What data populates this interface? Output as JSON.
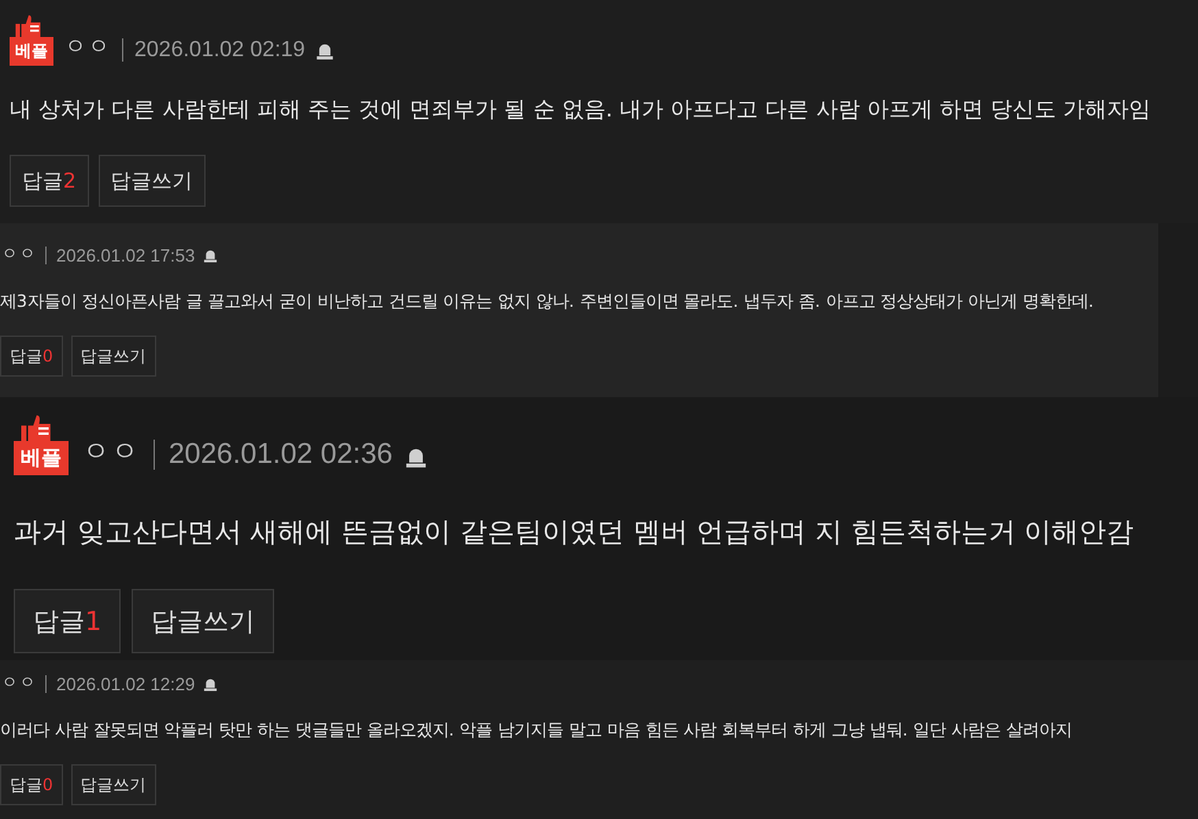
{
  "comments": [
    {
      "kind": "medium",
      "best": true,
      "badge": "베플",
      "author": "ㅇㅇ",
      "datetime": "2026.01.02 02:19",
      "text": "내 상처가 다른 사람한테 피해 주는 것에 면죄부가 될 순 없음. 내가 아프다고 다른 사람 아프게 하면 당신도 가해자임",
      "reply_label": "답글",
      "reply_count": "2",
      "write_label": "답글쓰기"
    },
    {
      "kind": "small",
      "best": false,
      "author": "ㅇㅇ",
      "datetime": "2026.01.02 17:53",
      "text": "제3자들이 정신아픈사람 글 끌고와서 굳이 비난하고 건드릴 이유는 없지 않나. 주변인들이면 몰라도. 냅두자 좀. 아프고 정상상태가 아닌게 명확한데.",
      "reply_label": "답글",
      "reply_count": "0",
      "write_label": "답글쓰기"
    },
    {
      "kind": "large",
      "best": true,
      "badge": "베플",
      "author": "ㅇㅇ",
      "datetime": "2026.01.02 02:36",
      "text": "과거 잊고산다면서 새해에 뜬금없이 같은팀이였던 멤버 언급하며 지 힘든척하는거 이해안감",
      "reply_label": "답글",
      "reply_count": "1",
      "write_label": "답글쓰기"
    },
    {
      "kind": "small",
      "best": false,
      "author": "ㅇㅇ",
      "datetime": "2026.01.02 12:29",
      "text": "이러다 사람 잘못되면 악플러 탓만 하는 댓글들만 올라오겠지. 악플 남기지들 말고 마음 힘든 사람 회복부터 하게 그냥 냅둬. 일단 사람은 살려아지",
      "reply_label": "답글",
      "reply_count": "0",
      "write_label": "답글쓰기"
    }
  ]
}
